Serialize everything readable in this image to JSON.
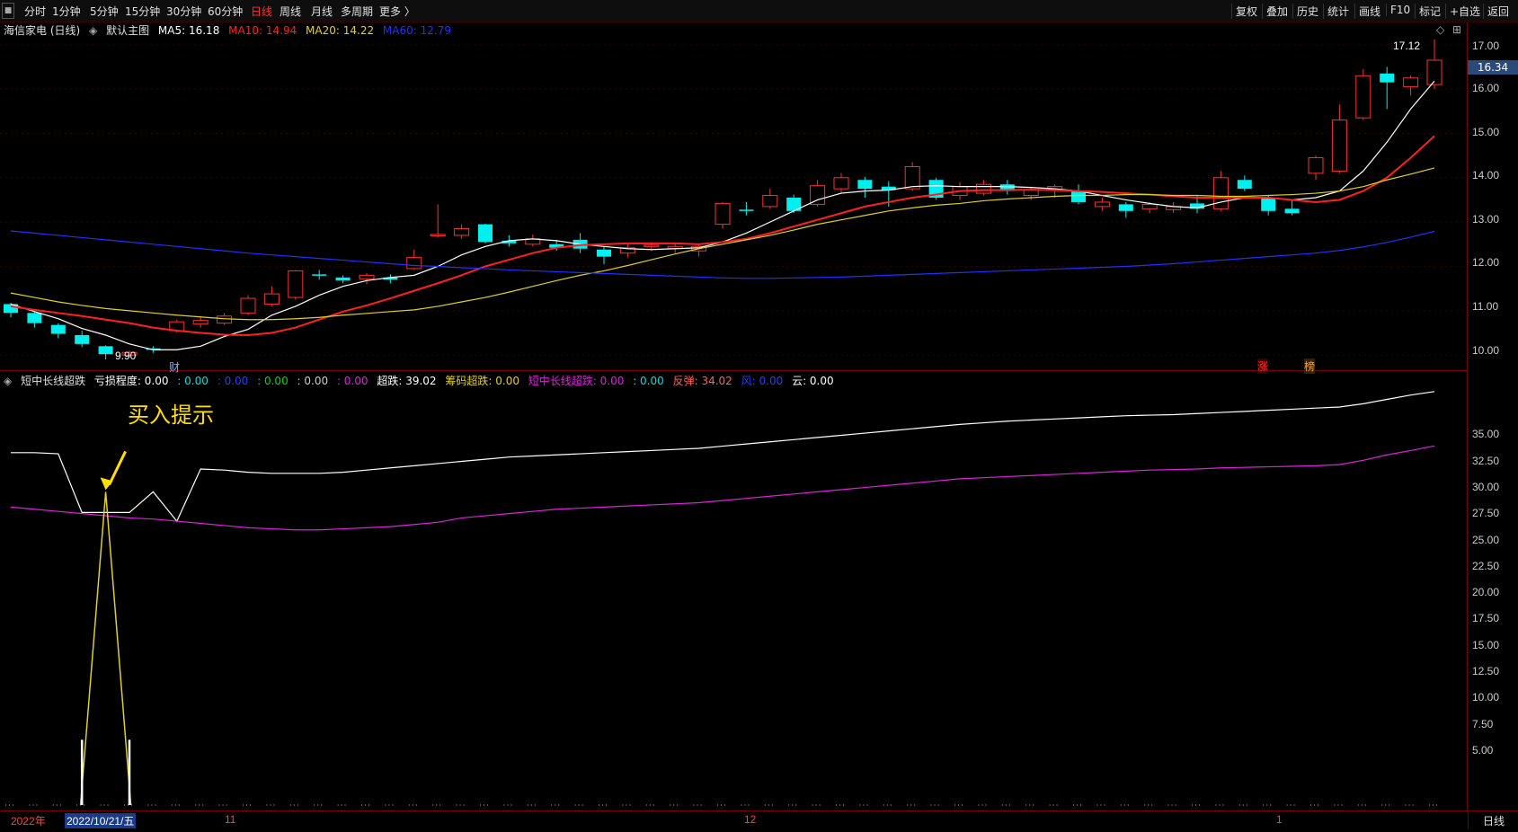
{
  "toolbar": {
    "menu_icon": "■",
    "periods": [
      "分时",
      "1分钟",
      "5分钟",
      "15分钟",
      "30分钟",
      "60分钟",
      "日线",
      "周线",
      "月线",
      "多周期",
      "更多 〉"
    ],
    "active_period": "日线",
    "right_actions": [
      "复权",
      "叠加",
      "历史",
      "统计",
      "画线",
      "F10",
      "标记",
      "+自选",
      "返回"
    ]
  },
  "main_legend": {
    "stock": "海信家电 (日线)",
    "template_icon": "◈",
    "template": "默认主图",
    "ma5": "MA5: 16.18",
    "ma10": "MA10: 14.94",
    "ma20": "MA20: 14.22",
    "ma60": "MA60: 12.79",
    "colors": {
      "ma5": "#ffffff",
      "ma10": "#ff2020",
      "ma20": "#e0d020",
      "ma60": "#2030ff"
    }
  },
  "indicator_legend": {
    "name": "短中长线超跌",
    "items": [
      {
        "text": "亏损程度: 0.00",
        "color": "#ffffff"
      },
      {
        "text": ": 0.00",
        "color": "#00e0e0"
      },
      {
        "text": ": 0.00",
        "color": "#2040ff"
      },
      {
        "text": ": 0.00",
        "color": "#00e000"
      },
      {
        "text": ": 0.00",
        "color": "#cccccc"
      },
      {
        "text": ": 0.00",
        "color": "#e020e0"
      },
      {
        "text": "超跌: 39.02",
        "color": "#ffffff"
      },
      {
        "text": "筹码超跌: 0.00",
        "color": "#e0d020"
      },
      {
        "text": "短中长线超跌: 0.00",
        "color": "#e020e0"
      },
      {
        "text": ": 0.00",
        "color": "#00e0e0"
      },
      {
        "text": "反弹: 34.02",
        "color": "#ff6060"
      },
      {
        "text": "风: 0.00",
        "color": "#2040ff"
      },
      {
        "text": "云: 0.00",
        "color": "#ffffff"
      }
    ]
  },
  "price_axis": [
    "17.00",
    "16.00",
    "15.00",
    "14.00",
    "13.00",
    "12.00",
    "11.00",
    "10.00"
  ],
  "current_price_tag": "16.34",
  "indicator_axis": [
    "35.00",
    "32.50",
    "30.00",
    "27.50",
    "25.00",
    "22.50",
    "20.00",
    "17.50",
    "15.00",
    "12.50",
    "10.00",
    "7.50",
    "5.00"
  ],
  "annotations": {
    "high": "17.12",
    "low": "9.90",
    "cai": "财",
    "zhang": "涨",
    "bang": "榜",
    "buy_hint": "买入提示",
    "diamond": "◇",
    "grid_icon": "⊞"
  },
  "dates": {
    "year": "2022年",
    "cursor": "2022/10/21/五",
    "nov": "11",
    "dec": "12",
    "jan": "1"
  },
  "period_button": "日线",
  "colors": {
    "up": "#ff3030",
    "down": "#00f0f0",
    "bg": "#000000",
    "frame": "#7a0000"
  },
  "chart_data": [
    {
      "type": "candlestick",
      "title": "海信家电 (日线)",
      "ylim": [
        9.7,
        17.4
      ],
      "candles": [
        [
          11.15,
          11.18,
          10.85,
          10.95
        ],
        [
          10.95,
          10.98,
          10.62,
          10.72
        ],
        [
          10.68,
          10.72,
          10.38,
          10.48
        ],
        [
          10.45,
          10.55,
          10.18,
          10.25
        ],
        [
          10.2,
          10.22,
          9.9,
          10.02
        ],
        [
          10.0,
          10.1,
          9.95,
          10.06
        ],
        [
          10.15,
          10.2,
          10.05,
          10.12
        ],
        [
          10.55,
          10.8,
          10.5,
          10.75
        ],
        [
          10.7,
          10.88,
          10.62,
          10.78
        ],
        [
          10.72,
          10.95,
          10.68,
          10.88
        ],
        [
          10.95,
          11.35,
          10.9,
          11.28
        ],
        [
          11.15,
          11.55,
          11.1,
          11.38
        ],
        [
          11.3,
          11.92,
          11.25,
          11.9
        ],
        [
          11.82,
          11.92,
          11.7,
          11.8
        ],
        [
          11.75,
          11.8,
          11.62,
          11.68
        ],
        [
          11.72,
          11.85,
          11.6,
          11.8
        ],
        [
          11.75,
          11.82,
          11.62,
          11.7
        ],
        [
          11.95,
          12.38,
          11.92,
          12.2
        ],
        [
          12.7,
          13.4,
          12.65,
          12.72
        ],
        [
          12.7,
          12.95,
          12.62,
          12.85
        ],
        [
          12.95,
          12.96,
          12.52,
          12.55
        ],
        [
          12.58,
          12.7,
          12.45,
          12.52
        ],
        [
          12.5,
          12.72,
          12.45,
          12.62
        ],
        [
          12.5,
          12.6,
          12.35,
          12.42
        ],
        [
          12.6,
          12.75,
          12.3,
          12.4
        ],
        [
          12.38,
          12.45,
          12.05,
          12.22
        ],
        [
          12.3,
          12.5,
          12.2,
          12.42
        ],
        [
          12.45,
          12.55,
          12.35,
          12.48
        ],
        [
          12.4,
          12.52,
          12.3,
          12.45
        ],
        [
          12.35,
          12.5,
          12.22,
          12.45
        ],
        [
          12.95,
          13.45,
          12.85,
          13.42
        ],
        [
          13.28,
          13.45,
          13.15,
          13.25
        ],
        [
          13.35,
          13.75,
          13.3,
          13.6
        ],
        [
          13.55,
          13.62,
          13.2,
          13.25
        ],
        [
          13.4,
          13.95,
          13.35,
          13.82
        ],
        [
          13.75,
          14.1,
          13.65,
          14.0
        ],
        [
          13.95,
          14.02,
          13.55,
          13.75
        ],
        [
          13.8,
          13.92,
          13.35,
          13.72
        ],
        [
          13.75,
          14.35,
          13.7,
          14.25
        ],
        [
          13.95,
          14.0,
          13.5,
          13.55
        ],
        [
          13.6,
          13.9,
          13.5,
          13.8
        ],
        [
          13.65,
          13.95,
          13.6,
          13.85
        ],
        [
          13.85,
          13.95,
          13.62,
          13.7
        ],
        [
          13.6,
          13.8,
          13.5,
          13.72
        ],
        [
          13.72,
          13.85,
          13.55,
          13.8
        ],
        [
          13.7,
          13.85,
          13.4,
          13.45
        ],
        [
          13.35,
          13.55,
          13.25,
          13.45
        ],
        [
          13.4,
          13.45,
          13.1,
          13.25
        ],
        [
          13.3,
          13.45,
          13.2,
          13.4
        ],
        [
          13.28,
          13.45,
          13.2,
          13.35
        ],
        [
          13.42,
          13.6,
          13.2,
          13.3
        ],
        [
          13.3,
          14.15,
          13.25,
          14.0
        ],
        [
          13.95,
          14.05,
          13.7,
          13.75
        ],
        [
          13.55,
          13.6,
          13.15,
          13.25
        ],
        [
          13.3,
          13.5,
          13.15,
          13.2
        ],
        [
          14.1,
          14.5,
          13.95,
          14.45
        ],
        [
          14.15,
          15.65,
          14.1,
          15.3
        ],
        [
          15.35,
          16.45,
          15.3,
          16.3
        ],
        [
          16.35,
          16.5,
          15.55,
          16.15
        ],
        [
          16.05,
          16.3,
          15.85,
          16.25
        ],
        [
          16.1,
          17.12,
          16.0,
          16.65
        ]
      ],
      "ma_lines": [
        {
          "name": "MA5",
          "color": "#ffffff",
          "values": [
            11.15,
            10.98,
            10.82,
            10.6,
            10.45,
            10.25,
            10.12,
            10.12,
            10.2,
            10.42,
            10.58,
            10.9,
            11.1,
            11.35,
            11.55,
            11.68,
            11.75,
            11.8,
            12.0,
            12.26,
            12.45,
            12.58,
            12.62,
            12.58,
            12.5,
            12.45,
            12.4,
            12.38,
            12.4,
            12.42,
            12.55,
            12.75,
            13.0,
            13.25,
            13.5,
            13.65,
            13.7,
            13.72,
            13.8,
            13.82,
            13.8,
            13.8,
            13.8,
            13.78,
            13.75,
            13.7,
            13.6,
            13.5,
            13.42,
            13.35,
            13.32,
            13.45,
            13.55,
            13.55,
            13.5,
            13.55,
            13.7,
            14.15,
            14.8,
            15.55,
            16.18
          ]
        },
        {
          "name": "MA10",
          "color": "#ff2020",
          "values": [
            11.1,
            11.02,
            10.95,
            10.88,
            10.8,
            10.72,
            10.62,
            10.55,
            10.5,
            10.46,
            10.45,
            10.5,
            10.62,
            10.8,
            10.98,
            11.12,
            11.28,
            11.45,
            11.62,
            11.8,
            12.0,
            12.15,
            12.3,
            12.42,
            12.48,
            12.5,
            12.52,
            12.52,
            12.52,
            12.5,
            12.55,
            12.62,
            12.75,
            12.9,
            13.05,
            13.2,
            13.35,
            13.45,
            13.55,
            13.62,
            13.7,
            13.72,
            13.72,
            13.73,
            13.72,
            13.7,
            13.68,
            13.65,
            13.62,
            13.58,
            13.55,
            13.55,
            13.55,
            13.55,
            13.5,
            13.45,
            13.5,
            13.7,
            14.0,
            14.45,
            14.94
          ]
        },
        {
          "name": "MA20",
          "color": "#e0d020",
          "values": [
            11.4,
            11.3,
            11.2,
            11.12,
            11.05,
            11.0,
            10.95,
            10.9,
            10.86,
            10.82,
            10.8,
            10.8,
            10.82,
            10.85,
            10.9,
            10.94,
            10.98,
            11.02,
            11.1,
            11.2,
            11.3,
            11.42,
            11.55,
            11.68,
            11.8,
            11.9,
            12.02,
            12.15,
            12.28,
            12.4,
            12.5,
            12.6,
            12.7,
            12.82,
            12.95,
            13.05,
            13.15,
            13.25,
            13.32,
            13.38,
            13.42,
            13.48,
            13.52,
            13.55,
            13.58,
            13.6,
            13.6,
            13.62,
            13.62,
            13.6,
            13.6,
            13.58,
            13.58,
            13.6,
            13.62,
            13.65,
            13.7,
            13.8,
            13.95,
            14.08,
            14.22
          ]
        },
        {
          "name": "MA60",
          "color": "#2030ff",
          "values": [
            12.8,
            12.75,
            12.7,
            12.65,
            12.6,
            12.55,
            12.5,
            12.45,
            12.4,
            12.35,
            12.3,
            12.26,
            12.22,
            12.18,
            12.14,
            12.1,
            12.06,
            12.02,
            12.0,
            11.97,
            11.95,
            11.92,
            11.9,
            11.88,
            11.86,
            11.84,
            11.82,
            11.8,
            11.78,
            11.76,
            11.74,
            11.73,
            11.73,
            11.74,
            11.75,
            11.76,
            11.78,
            11.8,
            11.82,
            11.84,
            11.86,
            11.88,
            11.9,
            11.92,
            11.94,
            11.96,
            11.98,
            12.0,
            12.03,
            12.06,
            12.1,
            12.14,
            12.18,
            12.22,
            12.26,
            12.3,
            12.36,
            12.44,
            12.54,
            12.66,
            12.79
          ]
        }
      ]
    },
    {
      "type": "line",
      "title": "短中长线超跌",
      "ylim": [
        1.0,
        39.5
      ],
      "series": [
        {
          "name": "超跌",
          "color": "#ffffff",
          "values": [
            33.4,
            33.4,
            33.3,
            27.9,
            27.9,
            27.9,
            29.8,
            27.1,
            31.9,
            31.8,
            31.6,
            31.5,
            31.5,
            31.5,
            31.6,
            31.8,
            32.0,
            32.2,
            32.4,
            32.6,
            32.8,
            33.0,
            33.1,
            33.2,
            33.3,
            33.4,
            33.5,
            33.6,
            33.7,
            33.8,
            34.0,
            34.2,
            34.4,
            34.6,
            34.8,
            35.0,
            35.2,
            35.4,
            35.6,
            35.8,
            36.0,
            36.15,
            36.3,
            36.4,
            36.5,
            36.6,
            36.7,
            36.8,
            36.85,
            36.9,
            37.0,
            37.1,
            37.2,
            37.3,
            37.4,
            37.5,
            37.6,
            37.9,
            38.3,
            38.7,
            39.02
          ]
        },
        {
          "name": "反弹",
          "color": "#e020e0",
          "values": [
            28.4,
            28.2,
            28.0,
            27.8,
            27.6,
            27.4,
            27.3,
            27.1,
            26.9,
            26.7,
            26.5,
            26.4,
            26.3,
            26.3,
            26.4,
            26.5,
            26.6,
            26.8,
            27.0,
            27.4,
            27.6,
            27.8,
            28.0,
            28.2,
            28.3,
            28.4,
            28.5,
            28.6,
            28.7,
            28.8,
            29.0,
            29.2,
            29.4,
            29.6,
            29.8,
            30.0,
            30.2,
            30.4,
            30.6,
            30.8,
            31.0,
            31.1,
            31.2,
            31.3,
            31.4,
            31.5,
            31.6,
            31.7,
            31.8,
            31.85,
            31.9,
            32.0,
            32.05,
            32.1,
            32.15,
            32.2,
            32.3,
            32.7,
            33.2,
            33.6,
            34.02
          ]
        },
        {
          "name": "买入提示",
          "color": "#e0d020",
          "values": [
            0,
            0,
            0,
            0,
            0,
            0,
            0,
            0,
            0,
            0,
            0,
            0,
            0,
            0,
            0,
            0,
            0,
            0,
            0,
            0,
            0,
            0,
            0,
            0,
            0,
            0,
            0,
            0,
            0,
            0,
            0,
            0,
            0,
            0,
            0,
            0,
            0,
            0,
            0,
            0,
            0,
            0,
            0,
            0,
            0,
            0,
            0,
            0,
            0,
            0,
            0,
            0,
            0,
            0,
            0,
            0,
            0,
            0,
            0,
            0,
            0
          ],
          "spikes": [
            {
              "index": 4,
              "value": 29.8
            }
          ]
        },
        {
          "name": "亏损程度",
          "color": "#ffffff",
          "values": [
            0,
            0,
            0,
            7.0,
            0,
            7.0,
            0,
            0,
            0,
            0,
            0,
            0,
            0,
            0,
            0,
            0,
            0,
            0,
            0,
            0,
            0,
            0,
            0,
            0,
            0,
            0,
            0,
            0,
            0,
            0,
            0,
            0,
            0,
            0,
            0,
            0,
            0,
            0,
            0,
            0,
            0,
            0,
            0,
            0,
            0,
            0,
            0,
            0,
            0,
            0,
            0,
            0,
            0,
            0,
            0,
            0,
            0,
            0,
            0,
            0,
            0
          ]
        }
      ]
    }
  ]
}
